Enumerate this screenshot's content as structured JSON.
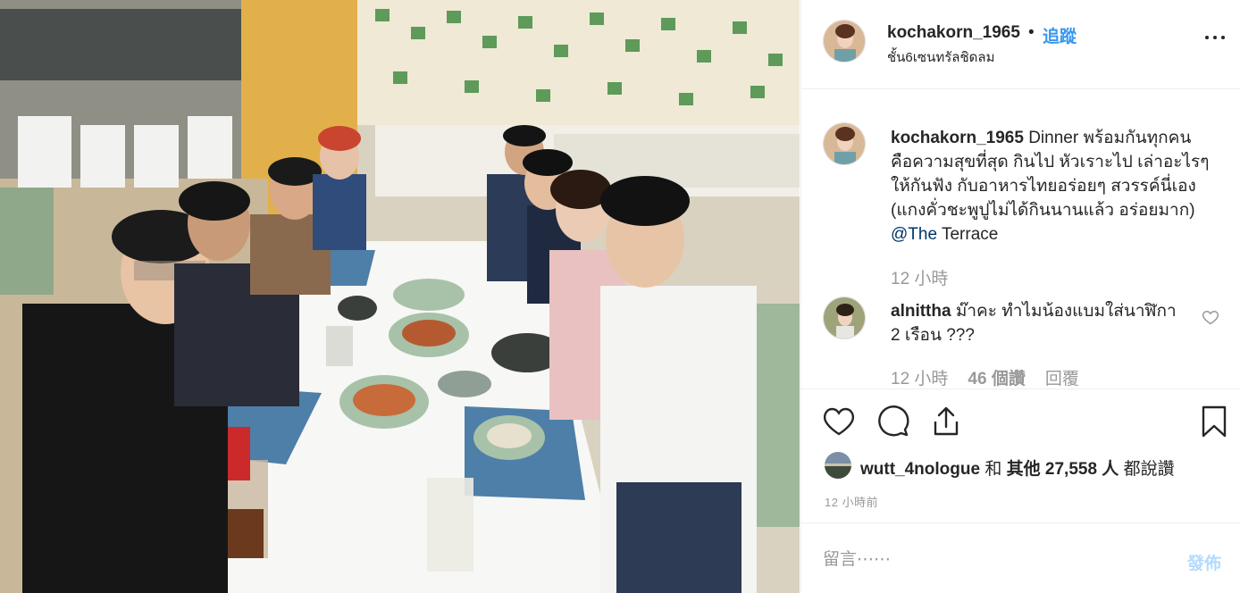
{
  "post": {
    "photo_alt": "group dinner photo at restaurant table",
    "header": {
      "username": "kochakorn_1965",
      "separator": "•",
      "follow_label": "追蹤",
      "location": "ชั้น6เซนทรัลชิดลม",
      "more_icon": "more-horizontal-icon"
    },
    "caption": {
      "username": "kochakorn_1965",
      "text": "Dinner พร้อมกันทุกคน คือความสุขที่สุด กินไป หัวเราะไป เล่าอะไรๆ ให้กันฟัง กับอาหารไทยอร่อยๆ สวรรค์นี่เอง (แกงคั่วชะพูปูไม่ได้กินนานแล้ว อร่อยมาก) ",
      "mention": "@The",
      "text_end": " Terrace",
      "time": "12 小時"
    },
    "comment": {
      "username": "alnittha",
      "text": "ม๊าคะ ทำไมน้องแบมใส่นาฬิกา 2 เรือน ???",
      "time": "12 小時",
      "likes": "46 個讚",
      "reply_label": "回覆",
      "heart_icon": "heart-outline-icon"
    },
    "actions": {
      "like_icon": "heart-icon",
      "comment_icon": "comment-icon",
      "share_icon": "share-icon",
      "save_icon": "bookmark-icon"
    },
    "likes": {
      "first_user": "wutt_4nologue",
      "and": " 和 ",
      "others": "其他 27,558 人",
      "suffix": " 都說讚"
    },
    "posted": "12 小時前",
    "add_comment": {
      "placeholder": "留言⋯⋯",
      "post_label": "發佈"
    },
    "colors": {
      "link": "#3897f0",
      "mention": "#003569",
      "muted": "#999999",
      "post_disabled": "#b3dbff"
    }
  }
}
